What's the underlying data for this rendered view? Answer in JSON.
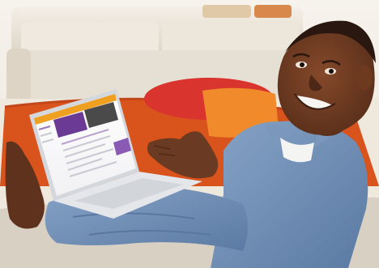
{
  "photo": {
    "subject": "man-with-laptop",
    "colors": {
      "wall": "#f2ede6",
      "sofa_back": "#ede7dd",
      "rug": "#d9531c",
      "cushion_red": "#d9342e",
      "cushion_orange": "#f08a2a",
      "shirt": "#6f8fb5",
      "skin": "#6b3a22",
      "laptop": "#e4e6ea",
      "site_header": "#f0a020",
      "site_accent": "#6a3a95"
    }
  }
}
